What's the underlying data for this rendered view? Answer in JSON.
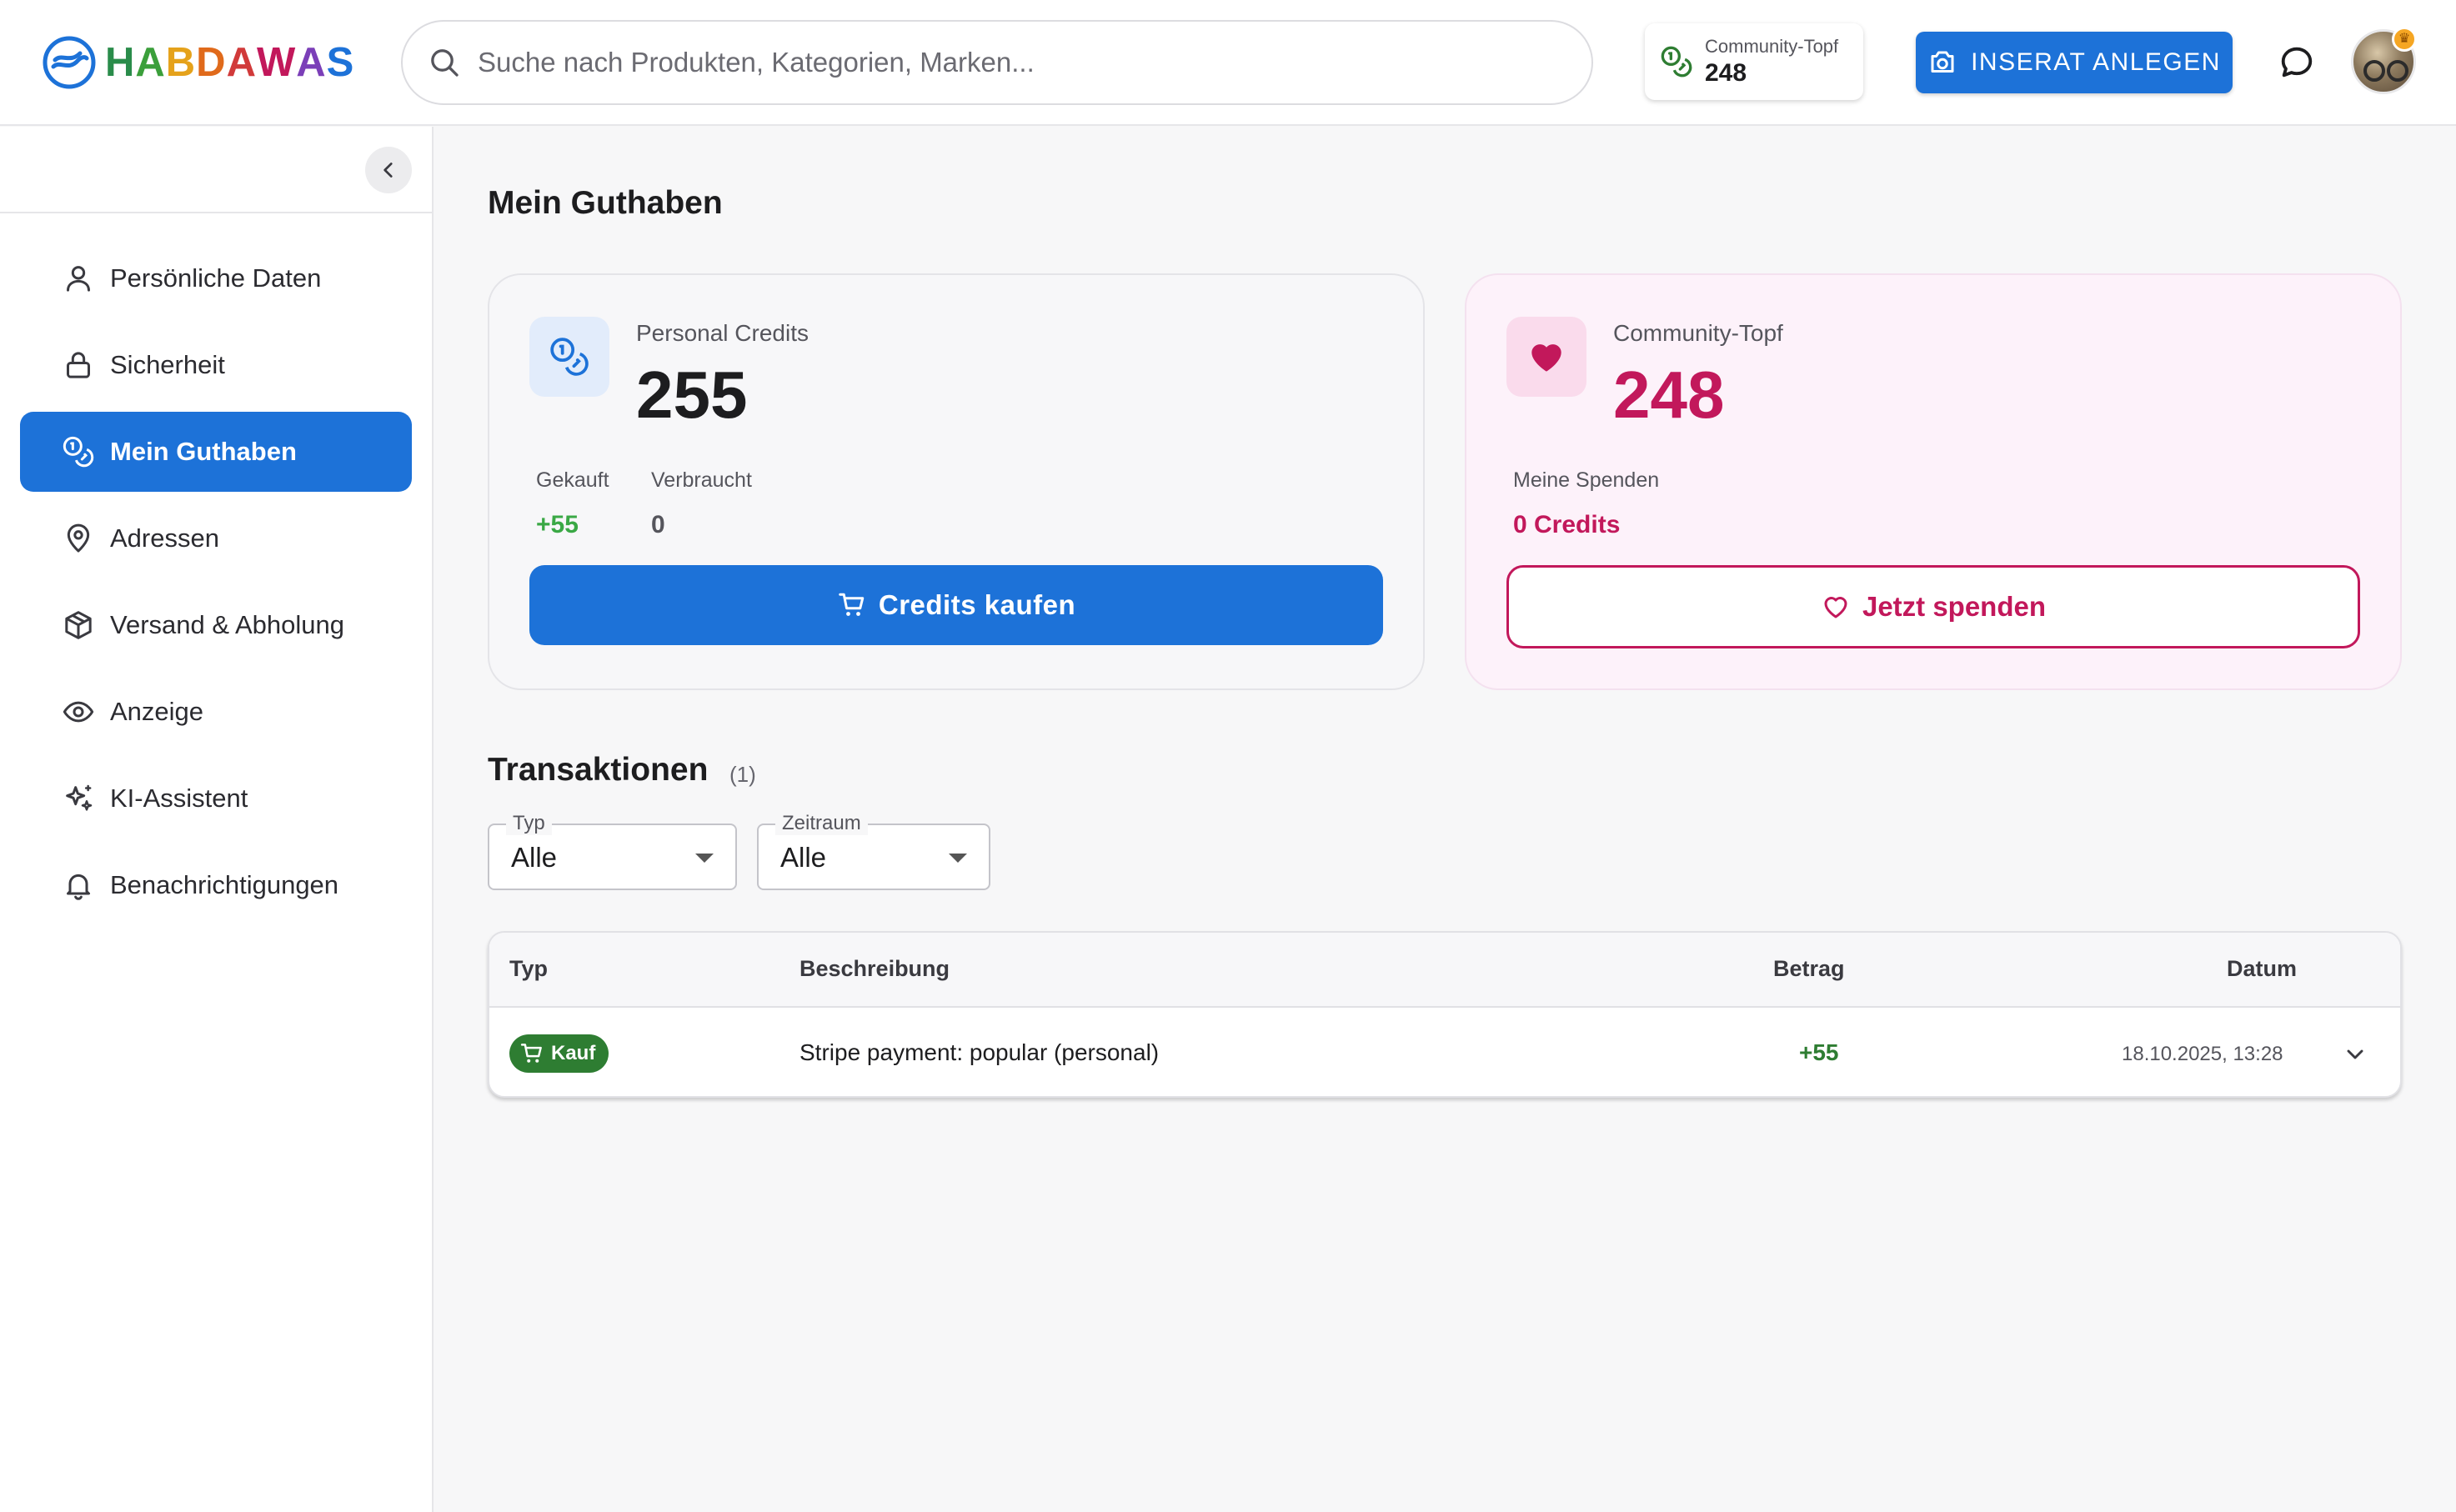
{
  "header": {
    "logo_text": [
      "H",
      "A",
      "B",
      "D",
      "A",
      "W",
      "A",
      "S"
    ],
    "logo_colors": [
      "#2a8c4a",
      "#3b9f3b",
      "#e5a21b",
      "#e06a1b",
      "#d13a3a",
      "#c2185b",
      "#7b3fb8",
      "#1d72d8"
    ],
    "search_placeholder": "Suche nach Produkten, Kategorien, Marken...",
    "pot_label": "Community-Topf",
    "pot_value": "248",
    "inserat_label": "INSERAT ANLEGEN"
  },
  "sidebar": {
    "items": [
      {
        "label": "Persönliche Daten",
        "icon": "user-icon",
        "active": false
      },
      {
        "label": "Sicherheit",
        "icon": "lock-icon",
        "active": false
      },
      {
        "label": "Mein Guthaben",
        "icon": "coins-icon",
        "active": true
      },
      {
        "label": "Adressen",
        "icon": "location-pin-icon",
        "active": false
      },
      {
        "label": "Versand & Abholung",
        "icon": "package-icon",
        "active": false
      },
      {
        "label": "Anzeige",
        "icon": "eye-icon",
        "active": false
      },
      {
        "label": "KI-Assistent",
        "icon": "sparkles-icon",
        "active": false
      },
      {
        "label": "Benachrichtigungen",
        "icon": "bell-icon",
        "active": false
      }
    ]
  },
  "main": {
    "title": "Mein Guthaben",
    "credits_card": {
      "label": "Personal Credits",
      "value": "255",
      "bought_label": "Gekauft",
      "bought_value": "+55",
      "used_label": "Verbraucht",
      "used_value": "0",
      "button_label": "Credits kaufen"
    },
    "pot_card": {
      "label": "Community-Topf",
      "value": "248",
      "donations_label": "Meine Spenden",
      "donations_value": "0 Credits",
      "button_label": "Jetzt spenden"
    },
    "transactions": {
      "title": "Transaktionen",
      "count": "(1)",
      "filters": {
        "type_label": "Typ",
        "type_value": "Alle",
        "period_label": "Zeitraum",
        "period_value": "Alle"
      },
      "columns": {
        "type": "Typ",
        "description": "Beschreibung",
        "amount": "Betrag",
        "date": "Datum"
      },
      "rows": [
        {
          "type": "Kauf",
          "description": "Stripe payment: popular (personal)",
          "amount": "+55",
          "date": "18.10.2025, 13:28"
        }
      ]
    }
  },
  "colors": {
    "primary": "#1d72d8",
    "donate": "#c2185b",
    "positive": "#2e7d32"
  }
}
